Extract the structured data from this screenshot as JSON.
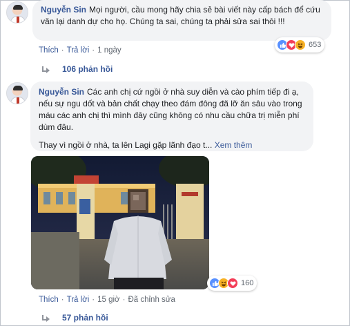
{
  "comments": [
    {
      "author": "Nguyễn Sin",
      "text": "Mọi người, cầu mong hãy chia sẻ bài viết này cấp bách để cứu vãn lại danh dự cho họ. Chúng ta sai, chúng ta phải sửa sai thôi !!!",
      "actions": {
        "like": "Thích",
        "reply": "Trả lời",
        "time": "1 ngày"
      },
      "reaction_count": "653",
      "replies": "106 phản hồi"
    },
    {
      "author": "Nguyễn Sin",
      "text": "Các anh chị cứ ngồi ở nhà suy diễn và cào phím tiếp đi ạ, nếu sự ngu dốt và bản chất chạy theo đám đông đã lỡ ăn sâu vào trong máu các anh chị thì mình đây cũng không có nhu cầu chữa trị miễn phí dùm đâu.",
      "text2": "Thay vì ngồi ở nhà, ta lên Lagi gặp lãnh đạo t...",
      "see_more": "Xem thêm",
      "actions": {
        "like": "Thích",
        "reply": "Trả lời",
        "time": "15 giờ",
        "edited": "Đã chỉnh sửa"
      },
      "reaction_count": "160",
      "replies": "57 phản hồi"
    }
  ],
  "colors": {
    "link": "#385898",
    "bubble": "#f2f3f5",
    "like": "#5890ff",
    "love": "#f33e58",
    "haha": "#f7b125"
  },
  "icons": {
    "like": "thumbs-up-icon",
    "love": "heart-icon",
    "haha": "laughing-icon",
    "reply_arrow": "reply-arrow-icon"
  }
}
